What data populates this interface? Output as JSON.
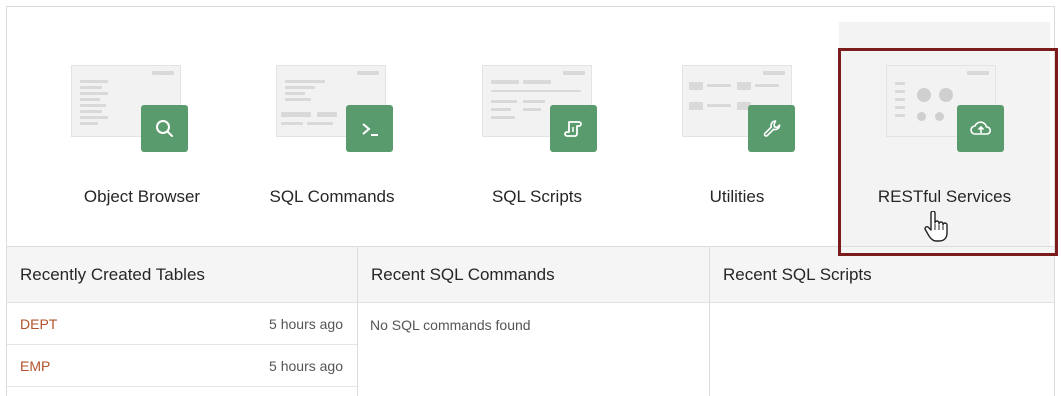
{
  "tiles": [
    {
      "label": "Object Browser",
      "icon": "search-icon"
    },
    {
      "label": "SQL Commands",
      "icon": "terminal-prompt-icon"
    },
    {
      "label": "SQL Scripts",
      "icon": "script-scroll-icon"
    },
    {
      "label": "Utilities",
      "icon": "wrench-icon"
    },
    {
      "label": "RESTful Services",
      "icon": "cloud-upload-icon"
    }
  ],
  "panels": {
    "tables": {
      "title": "Recently Created Tables",
      "rows": [
        {
          "name": "DEPT",
          "time": "5 hours ago"
        },
        {
          "name": "EMP",
          "time": "5 hours ago"
        }
      ]
    },
    "commands": {
      "title": "Recent SQL Commands",
      "empty": "No SQL commands found"
    },
    "scripts": {
      "title": "Recent SQL Scripts"
    }
  },
  "colors": {
    "badge": "#5a9b6e",
    "highlight_border": "#7a1c1c",
    "link": "#b2522b"
  }
}
